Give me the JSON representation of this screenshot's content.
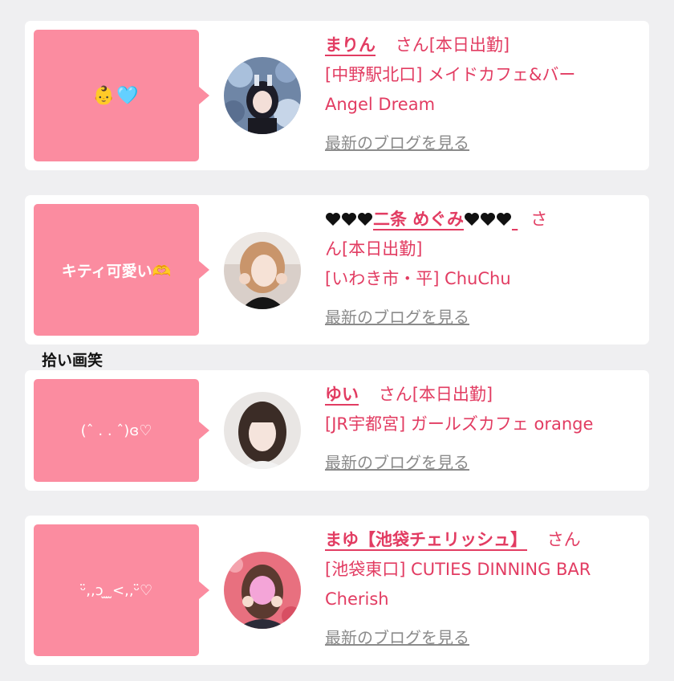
{
  "colors": {
    "accent": "#e23c62",
    "bubble": "#fb8ca0",
    "link_gray": "#8b8b8b",
    "background": "#efeff1"
  },
  "section_label": "拾い画笑",
  "cards": [
    {
      "message": "👶🩵",
      "name": "まりん",
      "san": "さん",
      "status": "[本日出勤]",
      "shop_line1": "[中野駅北口] メイドカフェ&バー",
      "shop_line2": "Angel Dream",
      "blog_link": "最新のブログを見る"
    },
    {
      "message": "キティ可愛い🫶",
      "name_prefix_icon": "black-heart-icon",
      "name": "二条 めぐみ",
      "san_part1": "さ",
      "san_part2": "ん",
      "status": "[本日出勤]",
      "shop_line1": "[いわき市・平] ChuChu",
      "blog_link": "最新のブログを見る"
    },
    {
      "message": "(ˆ . . ˆ)ɞ♡",
      "name": "ゆい",
      "san": "さん",
      "status": "[本日出勤]",
      "shop_line1": "[JR宇都宮] ガールズカフェ orange",
      "blog_link": "最新のブログを見る"
    },
    {
      "message": "ᵕ̈,,ↄ ̫ ̫<,,ᵕ̈♡",
      "name": "まゆ【池袋チェリッシュ】",
      "san": "さん",
      "shop_line1": "[池袋東口] CUTIES DINNING BAR",
      "shop_line2": "Cherish",
      "blog_link": "最新のブログを見る"
    }
  ]
}
